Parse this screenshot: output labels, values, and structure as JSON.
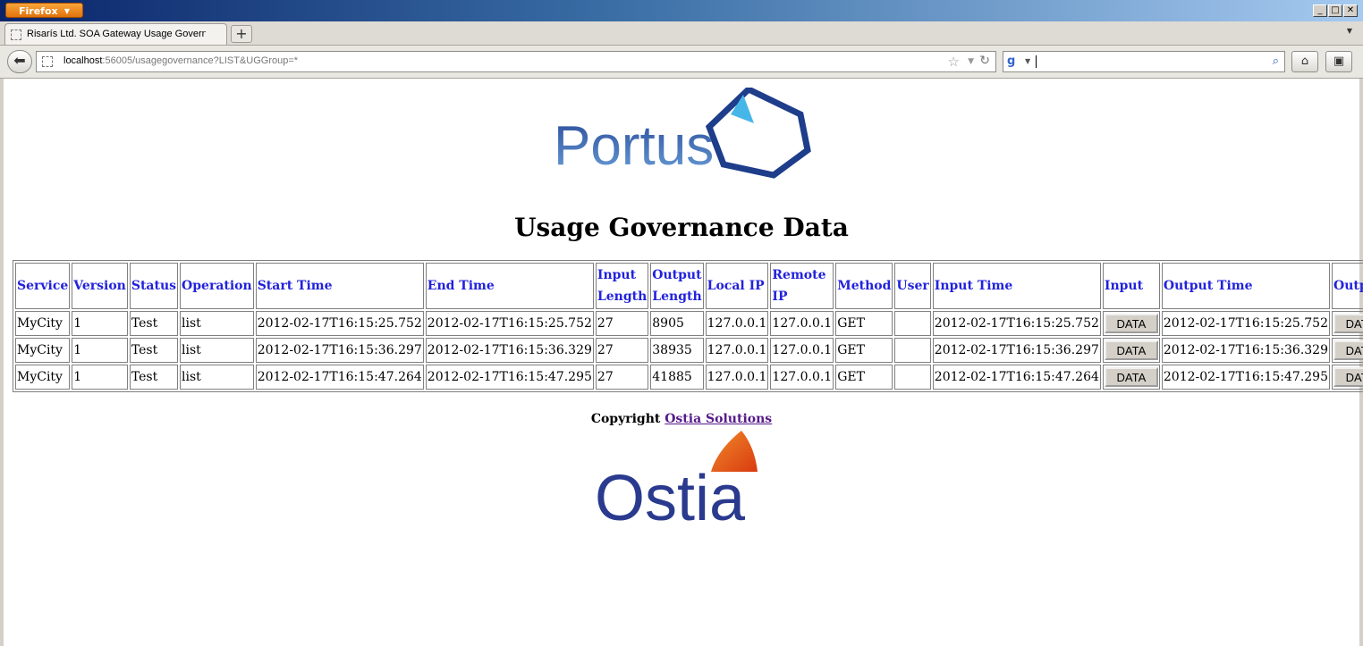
{
  "browser": {
    "app_button_label": "Firefox",
    "tab_title": "Risarís Ltd. SOA Gateway Usage Governanc...",
    "new_tab_label": "+",
    "url_host": "localhost",
    "url_rest": ":56005/usagegovernance?LIST&UGGroup=*",
    "search_value": ""
  },
  "logos": {
    "portus_text": "Portus",
    "ostia_text": "Ostia"
  },
  "page": {
    "title": "Usage Governance Data"
  },
  "table": {
    "headers": [
      "Service",
      "Version",
      "Status",
      "Operation",
      "Start Time",
      "End Time",
      "Input Length",
      "Output Length",
      "Local IP",
      "Remote IP",
      "Method",
      "User",
      "Input Time",
      "Input",
      "Output Time",
      "Output"
    ],
    "rows": [
      [
        "MyCity",
        "1",
        "Test",
        "list",
        "2012-02-17T16:15:25.752",
        "2012-02-17T16:15:25.752",
        "27",
        "8905",
        "127.0.0.1",
        "127.0.0.1",
        "GET",
        "",
        "2012-02-17T16:15:25.752",
        "DATA",
        "2012-02-17T16:15:25.752",
        "DATA"
      ],
      [
        "MyCity",
        "1",
        "Test",
        "list",
        "2012-02-17T16:15:36.297",
        "2012-02-17T16:15:36.329",
        "27",
        "38935",
        "127.0.0.1",
        "127.0.0.1",
        "GET",
        "",
        "2012-02-17T16:15:36.297",
        "DATA",
        "2012-02-17T16:15:36.329",
        "DATA"
      ],
      [
        "MyCity",
        "1",
        "Test",
        "list",
        "2012-02-17T16:15:47.264",
        "2012-02-17T16:15:47.295",
        "27",
        "41885",
        "127.0.0.1",
        "127.0.0.1",
        "GET",
        "",
        "2012-02-17T16:15:47.264",
        "DATA",
        "2012-02-17T16:15:47.295",
        "DATA"
      ]
    ]
  },
  "footer": {
    "copyright_prefix": "Copyright",
    "link_label": "Ostia Solutions"
  },
  "colors": {
    "header_link": "#2222dd",
    "portus_blue": "#2a4a9a",
    "ostia_orange": "#e8541c"
  },
  "icons": [
    "back-arrow-icon",
    "bookmark-star-icon",
    "reload-icon",
    "search-icon",
    "home-icon",
    "bookmarks-menu-icon"
  ]
}
